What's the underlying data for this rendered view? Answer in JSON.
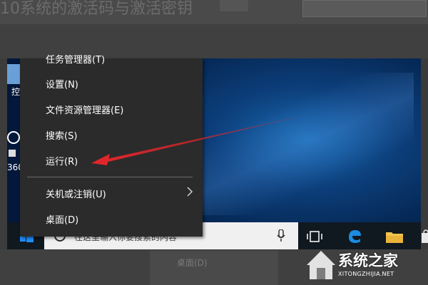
{
  "background": {
    "article_title": "10系统的激活码与激活密钥",
    "ghost_menu_label": "桌面(D)"
  },
  "desktop": {
    "icon_label_1": "控",
    "icon_label_2": "360"
  },
  "context_menu": {
    "items": [
      {
        "label": "任务管理器(T)"
      },
      {
        "label": "设置(N)"
      },
      {
        "label": "文件资源管理器(E)"
      },
      {
        "label": "搜索(S)"
      },
      {
        "label": "运行(R)"
      },
      {
        "label": "关机或注销(U)",
        "has_submenu": true
      },
      {
        "label": "桌面(D)"
      }
    ],
    "highlighted_item": "运行(R)"
  },
  "taskbar": {
    "search_placeholder": "在这里输入你要搜索的内容",
    "icons": [
      "windows-start-icon",
      "cortana-search-icon",
      "microphone-icon",
      "task-view-icon",
      "edge-browser-icon",
      "file-explorer-icon",
      "store-icon"
    ]
  },
  "annotation": {
    "arrow_color": "#e0262b",
    "points_to": "运行(R)"
  },
  "watermark": {
    "brand": "系统之家",
    "url": "XITONGZHIJIA.NET"
  },
  "colors": {
    "menu_bg": "#2b2b2b",
    "menu_text": "#ffffff",
    "desktop_blue": "#0c3e7a",
    "taskbar": "#101820"
  }
}
